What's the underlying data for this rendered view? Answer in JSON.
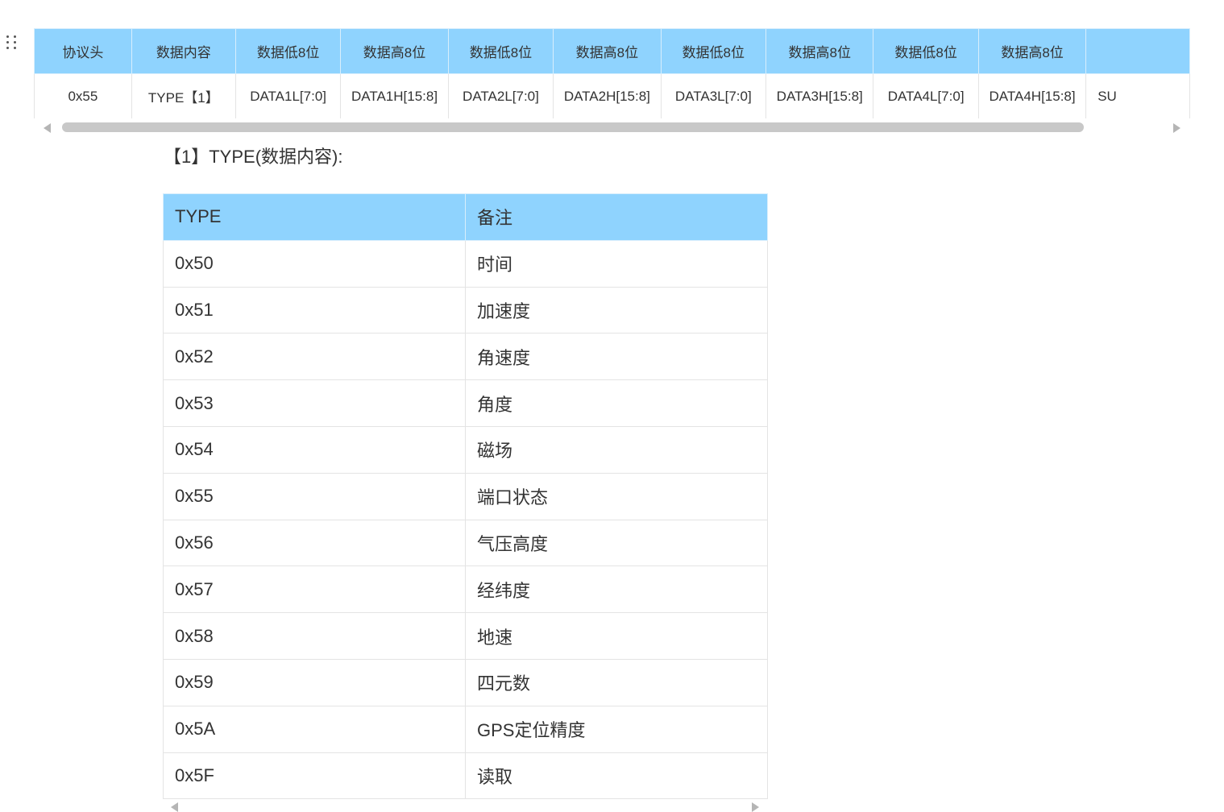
{
  "protocol_table": {
    "headers": [
      "协议头",
      "数据内容",
      "数据低8位",
      "数据高8位",
      "数据低8位",
      "数据高8位",
      "数据低8位",
      "数据高8位",
      "数据低8位",
      "数据高8位",
      ""
    ],
    "row": [
      "0x55",
      "TYPE【1】",
      "DATA1L[7:0]",
      "DATA1H[15:8]",
      "DATA2L[7:0]",
      "DATA2H[15:8]",
      "DATA3L[7:0]",
      "DATA3H[15:8]",
      "DATA4L[7:0]",
      "DATA4H[15:8]",
      "SU"
    ]
  },
  "section": {
    "heading": "【1】TYPE(数据内容):"
  },
  "type_table": {
    "headers": [
      "TYPE",
      "备注"
    ],
    "rows": [
      [
        "0x50",
        "时间"
      ],
      [
        "0x51",
        "加速度"
      ],
      [
        "0x52",
        "角速度"
      ],
      [
        "0x53",
        "角度"
      ],
      [
        "0x54",
        "磁场"
      ],
      [
        "0x55",
        "端口状态"
      ],
      [
        "0x56",
        "气压高度"
      ],
      [
        "0x57",
        "经纬度"
      ],
      [
        "0x58",
        "地速"
      ],
      [
        "0x59",
        "四元数"
      ],
      [
        "0x5A",
        "GPS定位精度"
      ],
      [
        "0x5F",
        "读取"
      ]
    ]
  },
  "colors": {
    "header_bg": "#8fd3fe",
    "border": "#e4e4e4",
    "scrollbar_thumb": "#c8c8c8"
  }
}
